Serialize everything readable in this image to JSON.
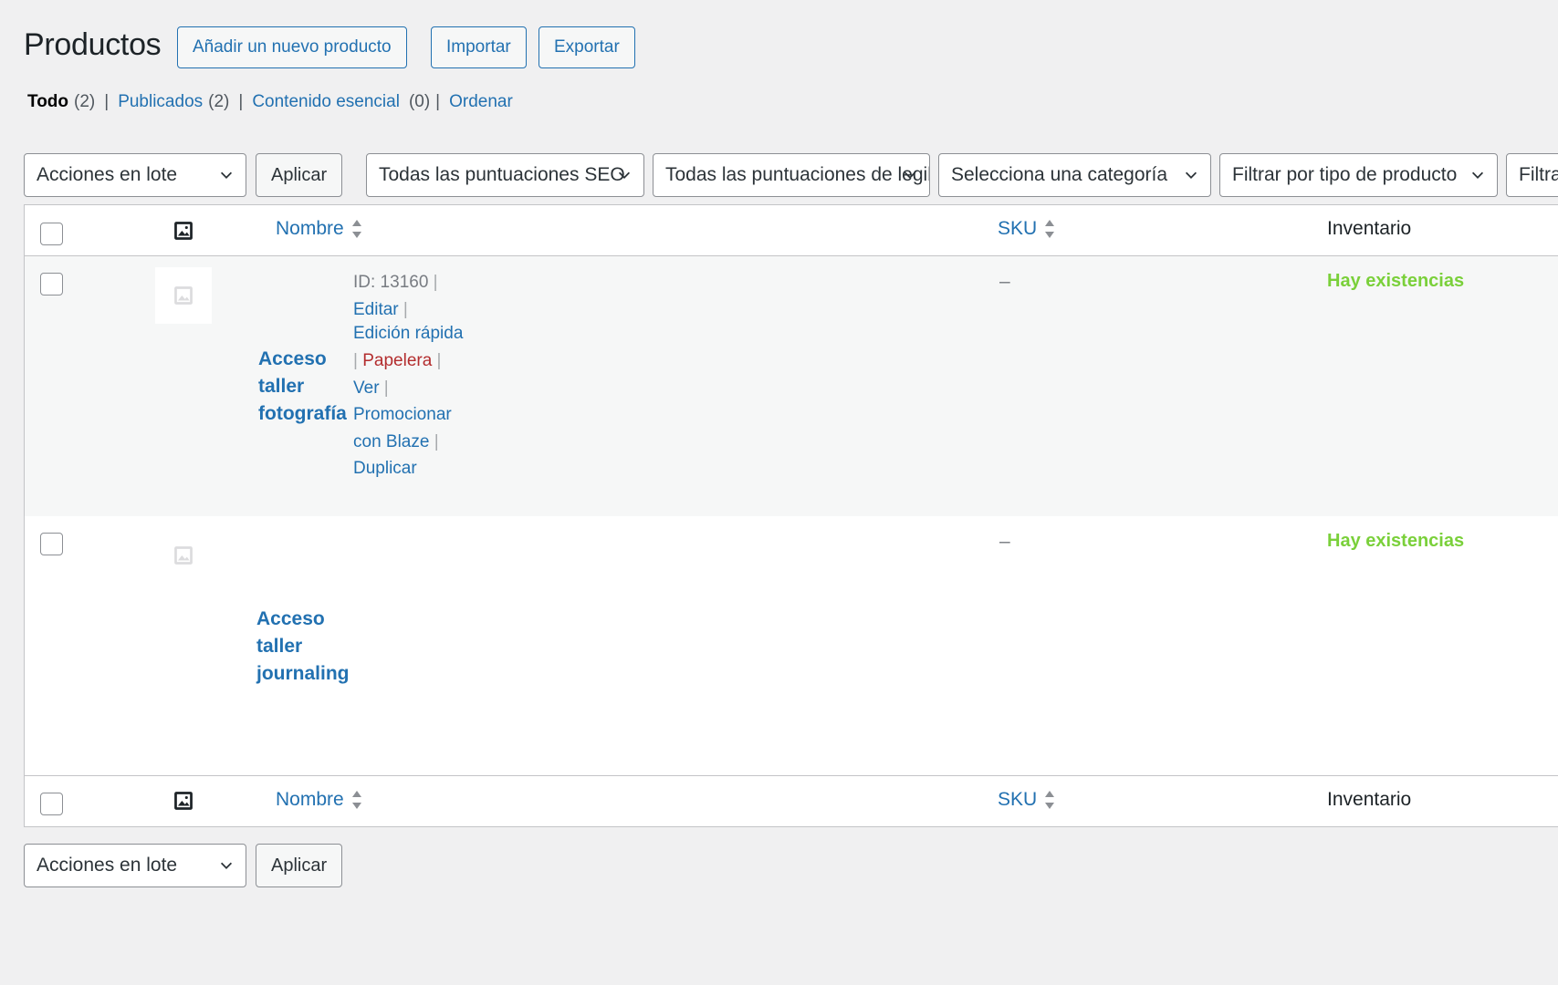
{
  "header": {
    "title": "Productos",
    "buttons": [
      "Añadir un nuevo producto",
      "Importar",
      "Exportar"
    ]
  },
  "views": [
    {
      "label": "Todo",
      "count": "(2)",
      "current": true
    },
    {
      "label": "Publicados",
      "count": "(2)"
    },
    {
      "label": "Contenido esencial",
      "count": "(0)"
    },
    {
      "label": "Ordenar",
      "count": ""
    }
  ],
  "filters": {
    "bulk_action": "Acciones en lote",
    "apply": "Aplicar",
    "seo_score": "Todas las puntuaciones SEO",
    "readability_score": "Todas las puntuaciones de legibilidad",
    "category": "Selecciona una categoría",
    "product_type": "Filtrar por tipo de producto",
    "stock_status": "Filtrar por estado de inventario"
  },
  "columns": {
    "name": "Nombre",
    "sku": "SKU",
    "stock": "Inventario"
  },
  "products": [
    {
      "name": "Acceso taller fotografía",
      "id_label": "ID: 13160",
      "actions": {
        "edit": "Editar",
        "quick_edit": "Edición rápida",
        "trash": "Papelera",
        "view": "Ver",
        "promote": "Promocionar con Blaze",
        "duplicate": "Duplicar"
      },
      "sku": "–",
      "stock": "Hay existencias"
    },
    {
      "name": "Acceso taller journaling",
      "sku": "–",
      "stock": "Hay existencias"
    }
  ],
  "bottom": {
    "bulk_action": "Acciones en lote",
    "apply": "Aplicar"
  },
  "colors": {
    "link": "#2271b1",
    "in_stock": "#7ad03a",
    "trash": "#b32d2e",
    "background": "#f0f0f1"
  },
  "icons": [
    "image-icon",
    "sort-icon",
    "chevron-down-icon",
    "placeholder-image-icon"
  ]
}
